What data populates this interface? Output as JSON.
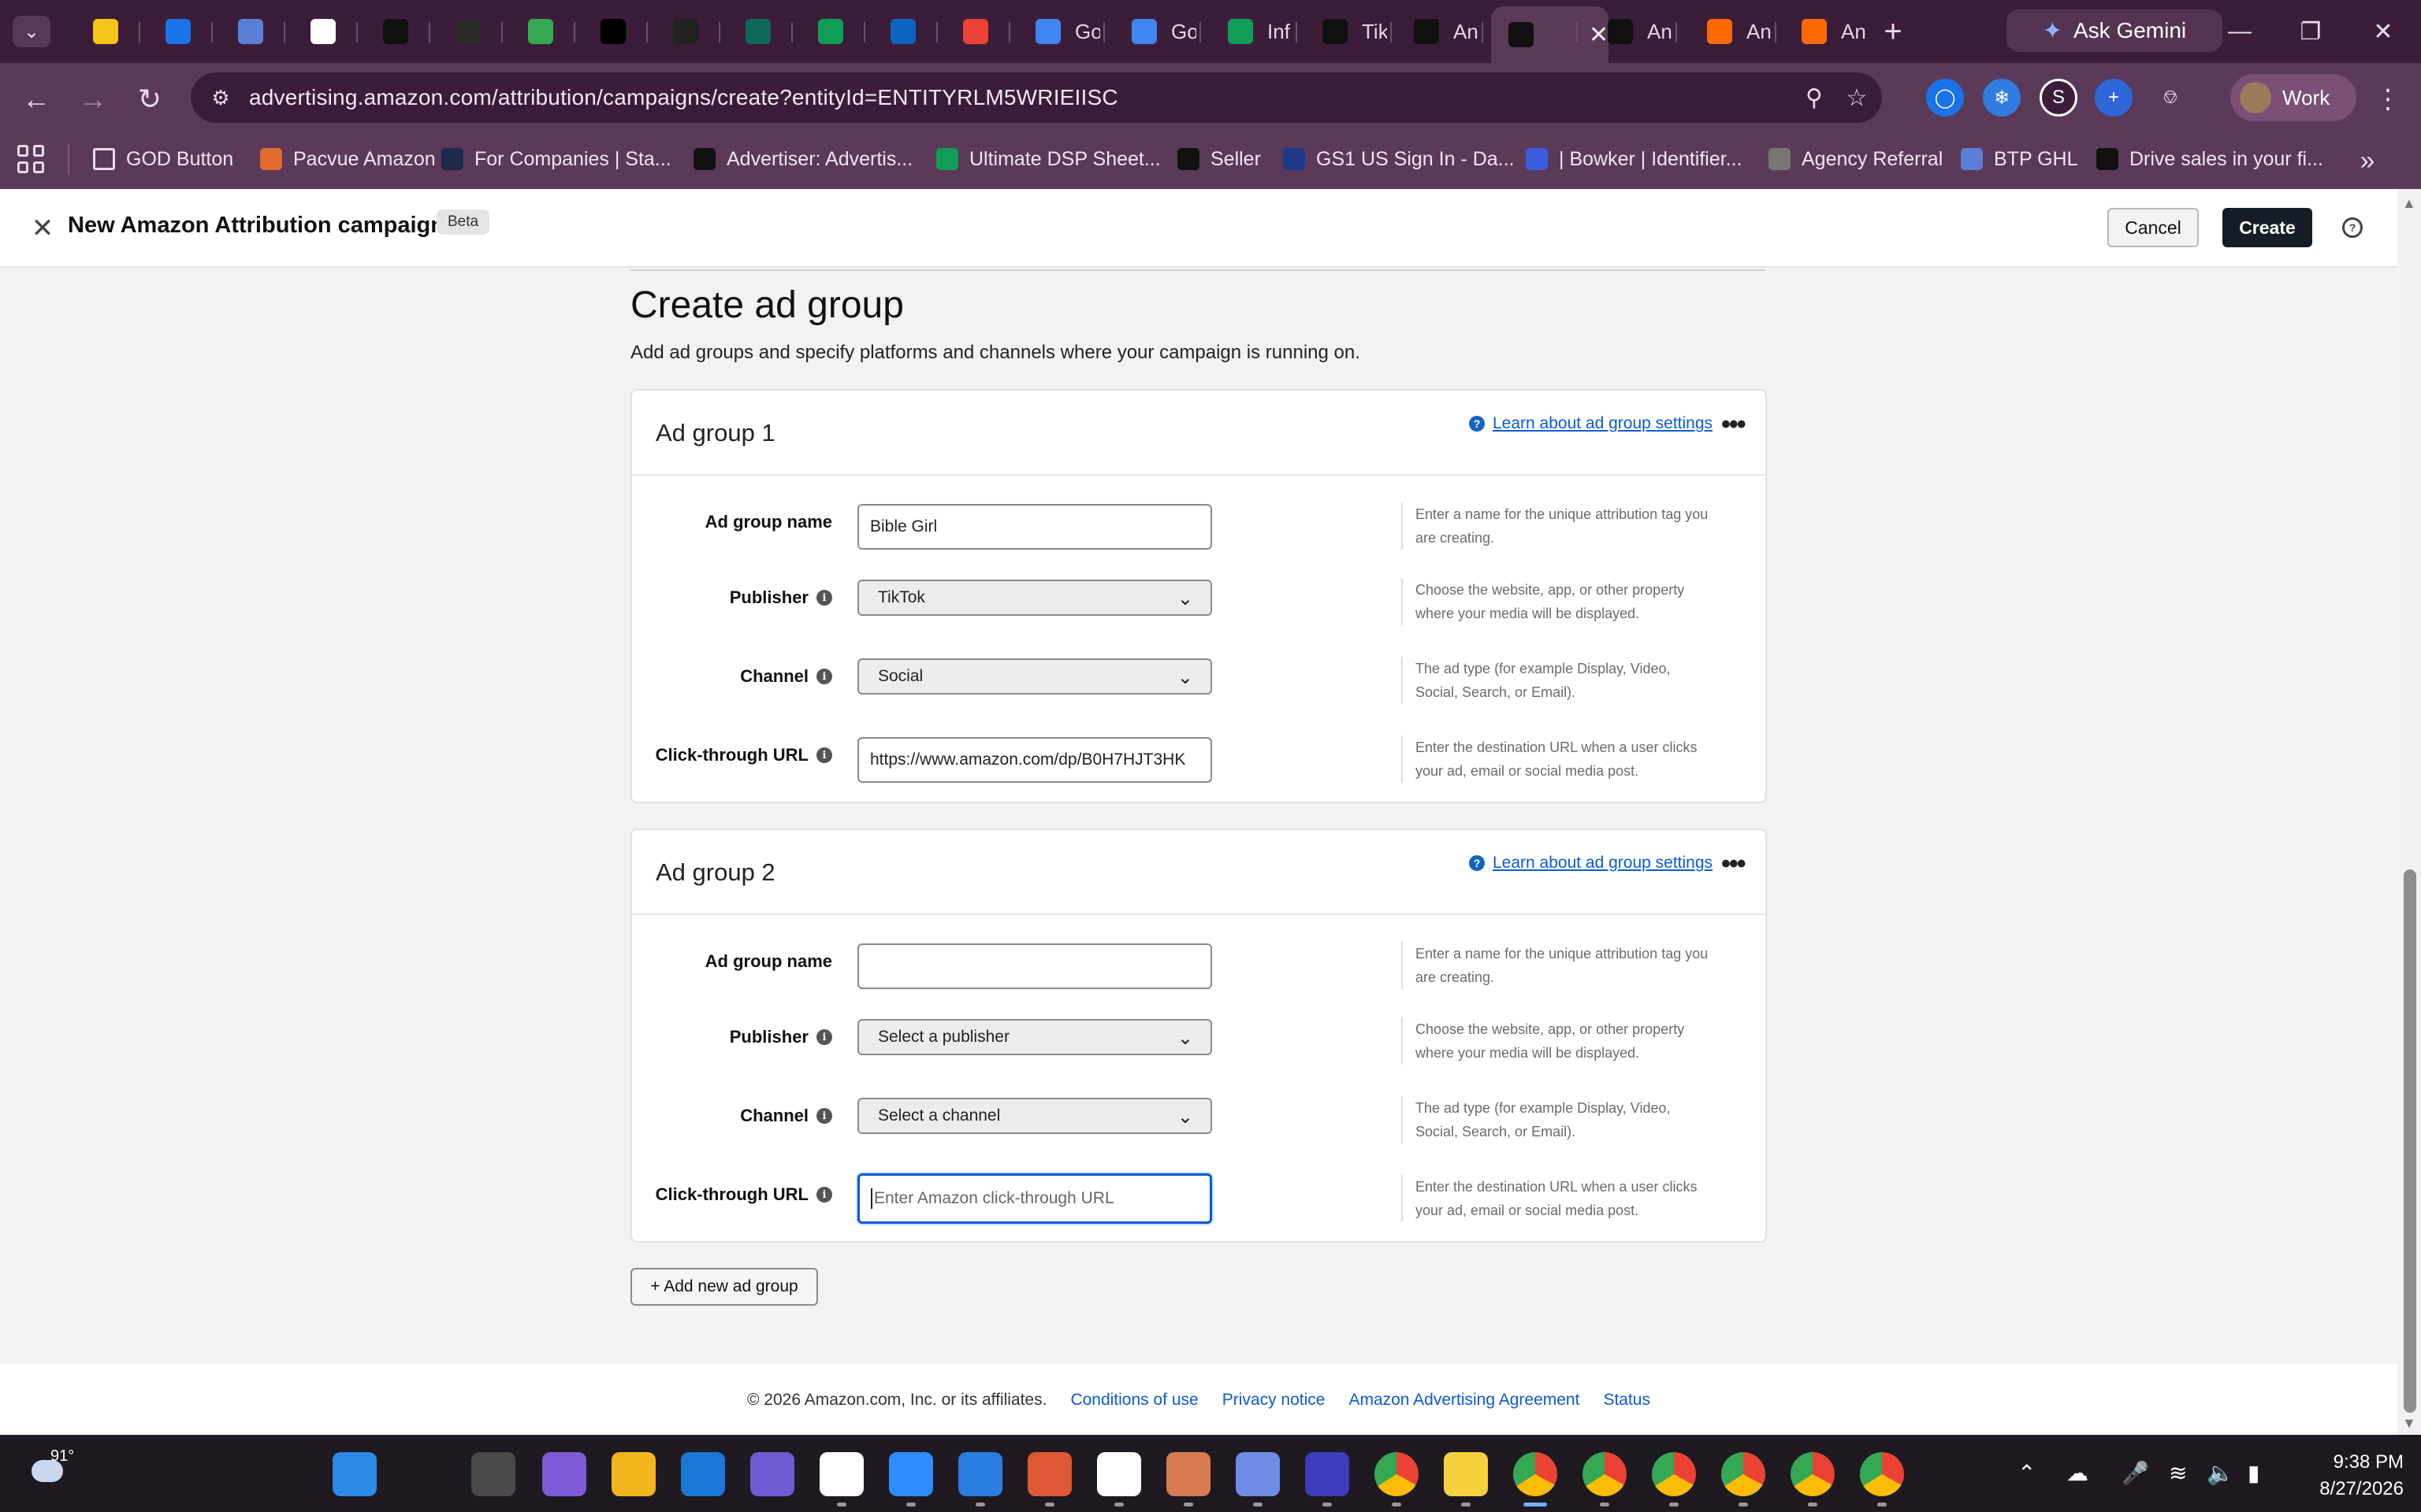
{
  "browser": {
    "tabs": [
      {
        "label": "",
        "icon": "lightbulb-icon",
        "color": "#f5c518"
      },
      {
        "label": "27",
        "icon": "calendar-icon",
        "color": "#1a73e8"
      },
      {
        "label": "",
        "icon": "diamond-logo-icon",
        "color": "#5b7fd6"
      },
      {
        "label": "",
        "icon": "clickup-icon",
        "color": "#ffffff"
      },
      {
        "label": "K",
        "icon": "k-logo-icon",
        "color": "#111111"
      },
      {
        "label": "SP",
        "icon": "sp-logo-icon",
        "color": "#2b2b2b"
      },
      {
        "label": "",
        "icon": "google-drive-icon",
        "color": "#34a853"
      },
      {
        "label": "",
        "icon": "triangle-logo-icon",
        "color": "#000000"
      },
      {
        "label": "",
        "icon": "can-you-icon",
        "color": "#222222"
      },
      {
        "label": "",
        "icon": "arrow-logo-icon",
        "color": "#0c6b58"
      },
      {
        "label": "",
        "icon": "sheets-icon",
        "color": "#0f9d58"
      },
      {
        "label": "in",
        "icon": "linkedin-icon",
        "color": "#0a66c2"
      },
      {
        "label": "M",
        "icon": "gmail-icon",
        "color": "#ea4335"
      },
      {
        "label": "Go",
        "icon": "google-docs-icon",
        "color": "#4285f4"
      },
      {
        "label": "Go",
        "icon": "google-docs-icon",
        "color": "#4285f4"
      },
      {
        "label": "Inf",
        "icon": "sheets-icon",
        "color": "#0f9d58"
      },
      {
        "label": "Tik",
        "icon": "tiktok-icon",
        "color": "#111111"
      },
      {
        "label": "An",
        "icon": "amazon-icon",
        "color": "#111111"
      },
      {
        "label": "",
        "icon": "amazon-smile-icon",
        "color": "#111111"
      },
      {
        "label": "An",
        "icon": "amazon-smile-icon",
        "color": "#111111"
      },
      {
        "label": "An",
        "icon": "amazon-orange-icon",
        "color": "#ff6a00"
      },
      {
        "label": "An",
        "icon": "amazon-orange-icon",
        "color": "#ff6a00"
      }
    ],
    "ask_gemini": "Ask Gemini",
    "url": "advertising.amazon.com/attribution/campaigns/create?entityId=ENTITYRLM5WRIEIISC",
    "profile_label": "Work",
    "bookmarks": [
      {
        "label": "GOD Button",
        "icon": "folder-icon"
      },
      {
        "label": "Pacvue Amazon",
        "icon": "pacvue-icon"
      },
      {
        "label": "For Companies | Sta...",
        "icon": "stackline-icon"
      },
      {
        "label": "Advertiser: Advertis...",
        "icon": "amazon-smile-icon"
      },
      {
        "label": "Ultimate DSP Sheet...",
        "icon": "sheets-icon"
      },
      {
        "label": "Seller",
        "icon": "amazon-icon"
      },
      {
        "label": "GS1 US Sign In - Da...",
        "icon": "gs1-icon"
      },
      {
        "label": "| Bowker | Identifier...",
        "icon": "bowker-icon"
      },
      {
        "label": "Agency Referral",
        "icon": "globe-icon"
      },
      {
        "label": "BTP GHL",
        "icon": "diamond-logo-icon"
      },
      {
        "label": "Drive sales in your fi...",
        "icon": "amazon-icon"
      }
    ]
  },
  "header": {
    "title": "New Amazon Attribution campaign",
    "badge": "Beta",
    "cancel_label": "Cancel",
    "create_label": "Create"
  },
  "main": {
    "title": "Create ad group",
    "subtitle": "Add ad groups and specify platforms and channels where your campaign is running on.",
    "help_link": "Learn about ad group settings",
    "labels": {
      "name": "Ad group name",
      "publisher": "Publisher",
      "channel": "Channel",
      "url": "Click-through URL"
    },
    "hints": {
      "name": "Enter a name for the unique attribution tag you are creating.",
      "publisher": "Choose the website, app, or other property where your media will be displayed.",
      "channel": "The ad type (for example Display, Video, Social, Search, or Email).",
      "url": "Enter the destination URL when a user clicks your ad, email or social media post."
    },
    "ad_groups": [
      {
        "title": "Ad group 1",
        "name_value": "Bible Girl",
        "publisher_value": "TikTok",
        "channel_value": "Social",
        "url_value": "https://www.amazon.com/dp/B0H7HJT3HK"
      },
      {
        "title": "Ad group 2",
        "name_value": "",
        "publisher_value": "Select a publisher",
        "channel_value": "Select a channel",
        "url_placeholder": "Enter Amazon click-through URL"
      }
    ],
    "add_group_label": "+ Add new ad group"
  },
  "footer": {
    "copyright": "© 2026 Amazon.com, Inc. or its affiliates.",
    "links": [
      "Conditions of use",
      "Privacy notice",
      "Amazon Advertising Agreement",
      "Status"
    ]
  },
  "taskbar": {
    "temperature": "91°",
    "time": "9:38 PM",
    "date": "8/27/2026",
    "apps": [
      "windows-start-icon",
      "search-icon",
      "task-view-icon",
      "copilot-icon",
      "file-explorer-icon",
      "edge-icon",
      "snipping-tool-icon",
      "slack-icon",
      "zoom-icon",
      "microsoft-store-icon",
      "duckduckgo-icon",
      "capcut-icon",
      "claude-icon",
      "gemini-icon",
      "grammarly-icon",
      "chrome-icon",
      "sticky-notes-icon",
      "chrome-icon",
      "chrome-icon",
      "chrome-icon",
      "chrome-icon",
      "chrome-icon",
      "chrome-icon"
    ]
  },
  "colors": {
    "tabstrip": "#3b1d3a",
    "toolbar": "#5b3a59",
    "primary_button": "#161d26",
    "link": "#0b5bd3",
    "focus": "#0a5ad6"
  }
}
